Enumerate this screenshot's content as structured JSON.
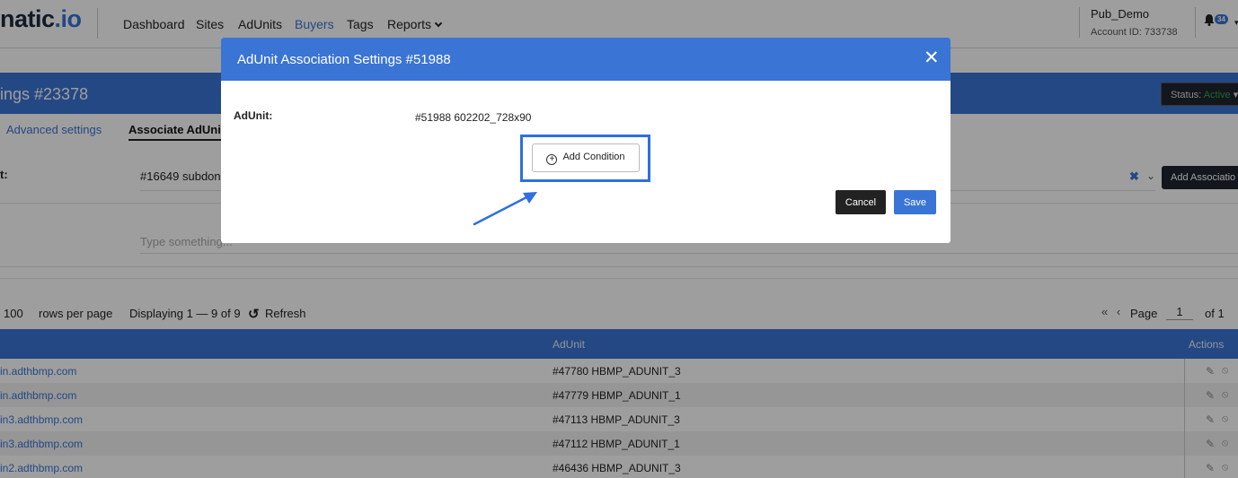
{
  "nav": {
    "logo_main": "natic",
    "logo_suffix": ".io",
    "items": [
      {
        "label": "Dashboard"
      },
      {
        "label": "Sites"
      },
      {
        "label": "AdUnits"
      },
      {
        "label": "Buyers",
        "active": true
      },
      {
        "label": "Tags"
      },
      {
        "label": "Reports"
      }
    ],
    "account_name": "Pub_Demo",
    "account_id": "Account ID: 733738",
    "notification_count": "34"
  },
  "settings": {
    "title": "ings #23378",
    "status_label": "Status:",
    "status_value": "Active",
    "tabs": [
      {
        "label": "Advanced settings"
      },
      {
        "label": "Associate AdUnits"
      }
    ],
    "row_label": "t:",
    "selected_value": "#16649 subdon",
    "associate_button": "Add Associatio",
    "search_placeholder": "Type something..."
  },
  "pager": {
    "rows_value": "100",
    "rows_label": "rows per page",
    "displaying": "Displaying 1 — 9 of 9",
    "refresh": "Refresh",
    "page_label": "Page",
    "page_value": "1",
    "page_of": "of 1"
  },
  "table": {
    "columns": {
      "adunit": "AdUnit",
      "actions": "Actions"
    },
    "rows": [
      {
        "site": "in.adthbmp.com",
        "adunit": "#47780 HBMP_ADUNIT_3"
      },
      {
        "site": "in.adthbmp.com",
        "adunit": "#47779 HBMP_ADUNIT_1"
      },
      {
        "site": "in3.adthbmp.com",
        "adunit": "#47113 HBMP_ADUNIT_3"
      },
      {
        "site": "in3.adthbmp.com",
        "adunit": "#47112 HBMP_ADUNIT_1"
      },
      {
        "site": "in2.adthbmp.com",
        "adunit": "#46436 HBMP_ADUNIT_3"
      }
    ]
  },
  "modal": {
    "title": "AdUnit Association Settings #51988",
    "adunit_label": "AdUnit:",
    "adunit_value": "#51988 602202_728x90",
    "add_condition": "Add Condition",
    "cancel": "Cancel",
    "save": "Save"
  },
  "colors": {
    "accent": "#3a74d4",
    "highlight_box": "#2f6fe0",
    "dark_button": "#222222"
  }
}
